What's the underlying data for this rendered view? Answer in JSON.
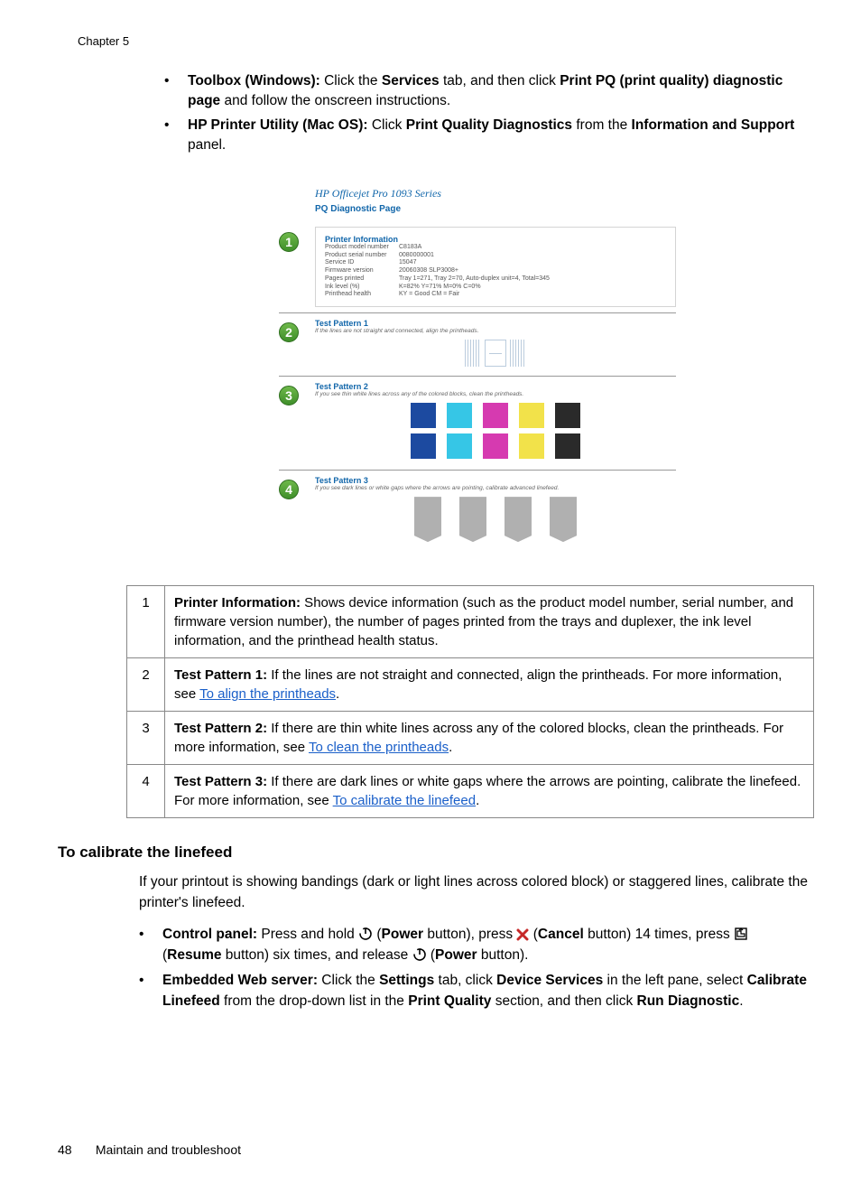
{
  "chapter": "Chapter 5",
  "top_bullets": [
    {
      "b1": "Toolbox (Windows):",
      "t1": " Click the ",
      "b2": "Services",
      "t2": " tab, and then click ",
      "b3": "Print PQ (print quality) diagnostic page",
      "t3": " and follow the onscreen instructions."
    },
    {
      "b1": "HP Printer Utility (Mac OS):",
      "t1": " Click ",
      "b2": "Print Quality Diagnostics",
      "t2": " from the ",
      "b3": "Information and Support",
      "t3": " panel."
    }
  ],
  "diagram": {
    "header": "HP Officejet Pro 1093 Series",
    "subheader": "PQ Diagnostic Page",
    "callouts": [
      "1",
      "2",
      "3",
      "4"
    ],
    "printerInfo": {
      "title": "Printer Information",
      "labels": [
        "Product model number",
        "Product serial number",
        "Service ID",
        "Firmware version",
        "Pages printed",
        "Ink level (%)",
        "Printhead health"
      ],
      "vals": [
        "C8183A",
        "0080000001",
        "15047",
        "20060308 SLP3008+",
        "Tray 1=271, Tray 2=70, Auto-duplex unit=4, Total=345",
        "K=82%   Y=71%   M=0%   C=0%",
        "KY = Good CM = Fair"
      ]
    },
    "tp1_title": "Test Pattern 1",
    "tp1_sub": "If the lines are not straight and connected, align the printheads.",
    "tp2_title": "Test Pattern 2",
    "tp2_sub": "If you see thin white lines across any of the colored blocks, clean the printheads.",
    "tp3_title": "Test Pattern 3",
    "tp3_sub": "If you see dark lines or white gaps where the arrows are pointing, calibrate advanced linefeed."
  },
  "legend": [
    {
      "n": "1",
      "b": "Printer Information:",
      "t": " Shows device information (such as the product model number, serial number, and firmware version number), the number of pages printed from the trays and duplexer, the ink level information, and the printhead health status."
    },
    {
      "n": "2",
      "b": "Test Pattern 1:",
      "t": " If the lines are not straight and connected, align the printheads. For more information, see ",
      "link": "To align the printheads",
      "after": "."
    },
    {
      "n": "3",
      "b": "Test Pattern 2:",
      "t": " If there are thin white lines across any of the colored blocks, clean the printheads. For more information, see ",
      "link": "To clean the printheads",
      "after": "."
    },
    {
      "n": "4",
      "b": "Test Pattern 3:",
      "t": " If there are dark lines or white gaps where the arrows are pointing, calibrate the linefeed. For more information, see ",
      "link": "To calibrate the linefeed",
      "after": "."
    }
  ],
  "heading2": "To calibrate the linefeed",
  "para1": "If your printout is showing bandings (dark or light lines across colored block) or staggered lines, calibrate the printer's linefeed.",
  "bot": [
    {
      "b1": "Control panel:",
      "parts": [
        {
          "t": " Press and hold "
        },
        {
          "icon": "power"
        },
        {
          "t": " ("
        },
        {
          "b": "Power"
        },
        {
          "t": " button), press "
        },
        {
          "icon": "cancel"
        },
        {
          "t": " ("
        },
        {
          "b": "Cancel"
        },
        {
          "t": " button) 14 times, press "
        },
        {
          "icon": "resume"
        },
        {
          "t": " ("
        },
        {
          "b": "Resume"
        },
        {
          "t": " button) six times, and release "
        },
        {
          "icon": "power"
        },
        {
          "t": " ("
        },
        {
          "b": "Power"
        },
        {
          "t": " button)."
        }
      ]
    },
    {
      "b1": "Embedded Web server:",
      "parts": [
        {
          "t": " Click the "
        },
        {
          "b": "Settings"
        },
        {
          "t": " tab, click "
        },
        {
          "b": "Device Services"
        },
        {
          "t": " in the left pane, select "
        },
        {
          "b": "Calibrate Linefeed"
        },
        {
          "t": " from the drop-down list in the "
        },
        {
          "b": "Print Quality"
        },
        {
          "t": " section, and then click "
        },
        {
          "b": "Run Diagnostic"
        },
        {
          "t": "."
        }
      ]
    }
  ],
  "footer": {
    "page": "48",
    "section": "Maintain and troubleshoot"
  }
}
